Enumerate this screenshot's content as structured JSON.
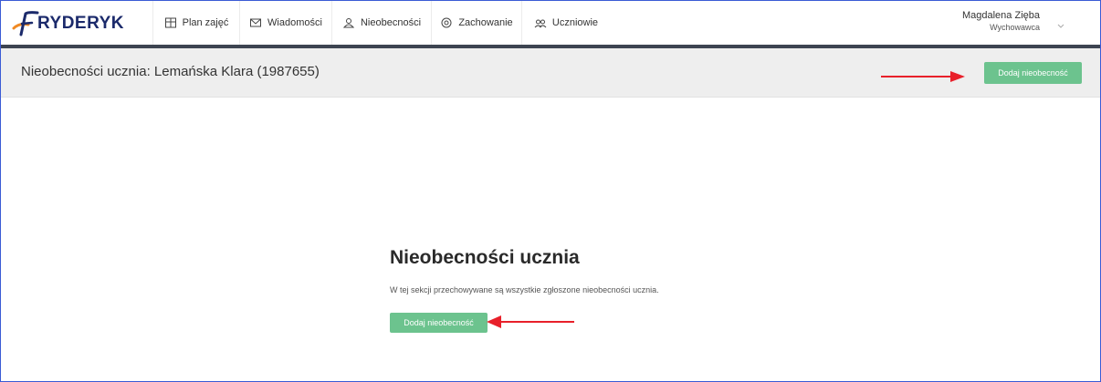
{
  "app": {
    "logo_text": "RYDERYK",
    "brand_color": "#1b2a6b",
    "accent_color": "#f08a24"
  },
  "nav": {
    "items": [
      {
        "label": "Plan zajęć",
        "icon": "calendar-grid-icon"
      },
      {
        "label": "Wiadomości",
        "icon": "envelope-icon"
      },
      {
        "label": "Nieobecności",
        "icon": "person-icon"
      },
      {
        "label": "Zachowanie",
        "icon": "smile-icon"
      },
      {
        "label": "Uczniowie",
        "icon": "group-icon"
      }
    ]
  },
  "user": {
    "name": "Magdalena Zięba",
    "role": "Wychowawca"
  },
  "header": {
    "title": "Nieobecności ucznia: Lemańska Klara (1987655)",
    "add_button_label": "Dodaj nieobecność"
  },
  "empty_state": {
    "title": "Nieobecności ucznia",
    "description": "W tej sekcji przechowywane są wszystkie zgłoszone nieobecności ucznia.",
    "add_button_label": "Dodaj nieobecność"
  },
  "colors": {
    "button_green": "#6cc38e",
    "annotation_red": "#e8202a",
    "header_bg": "#eeeeee",
    "strip": "#3d4451"
  }
}
